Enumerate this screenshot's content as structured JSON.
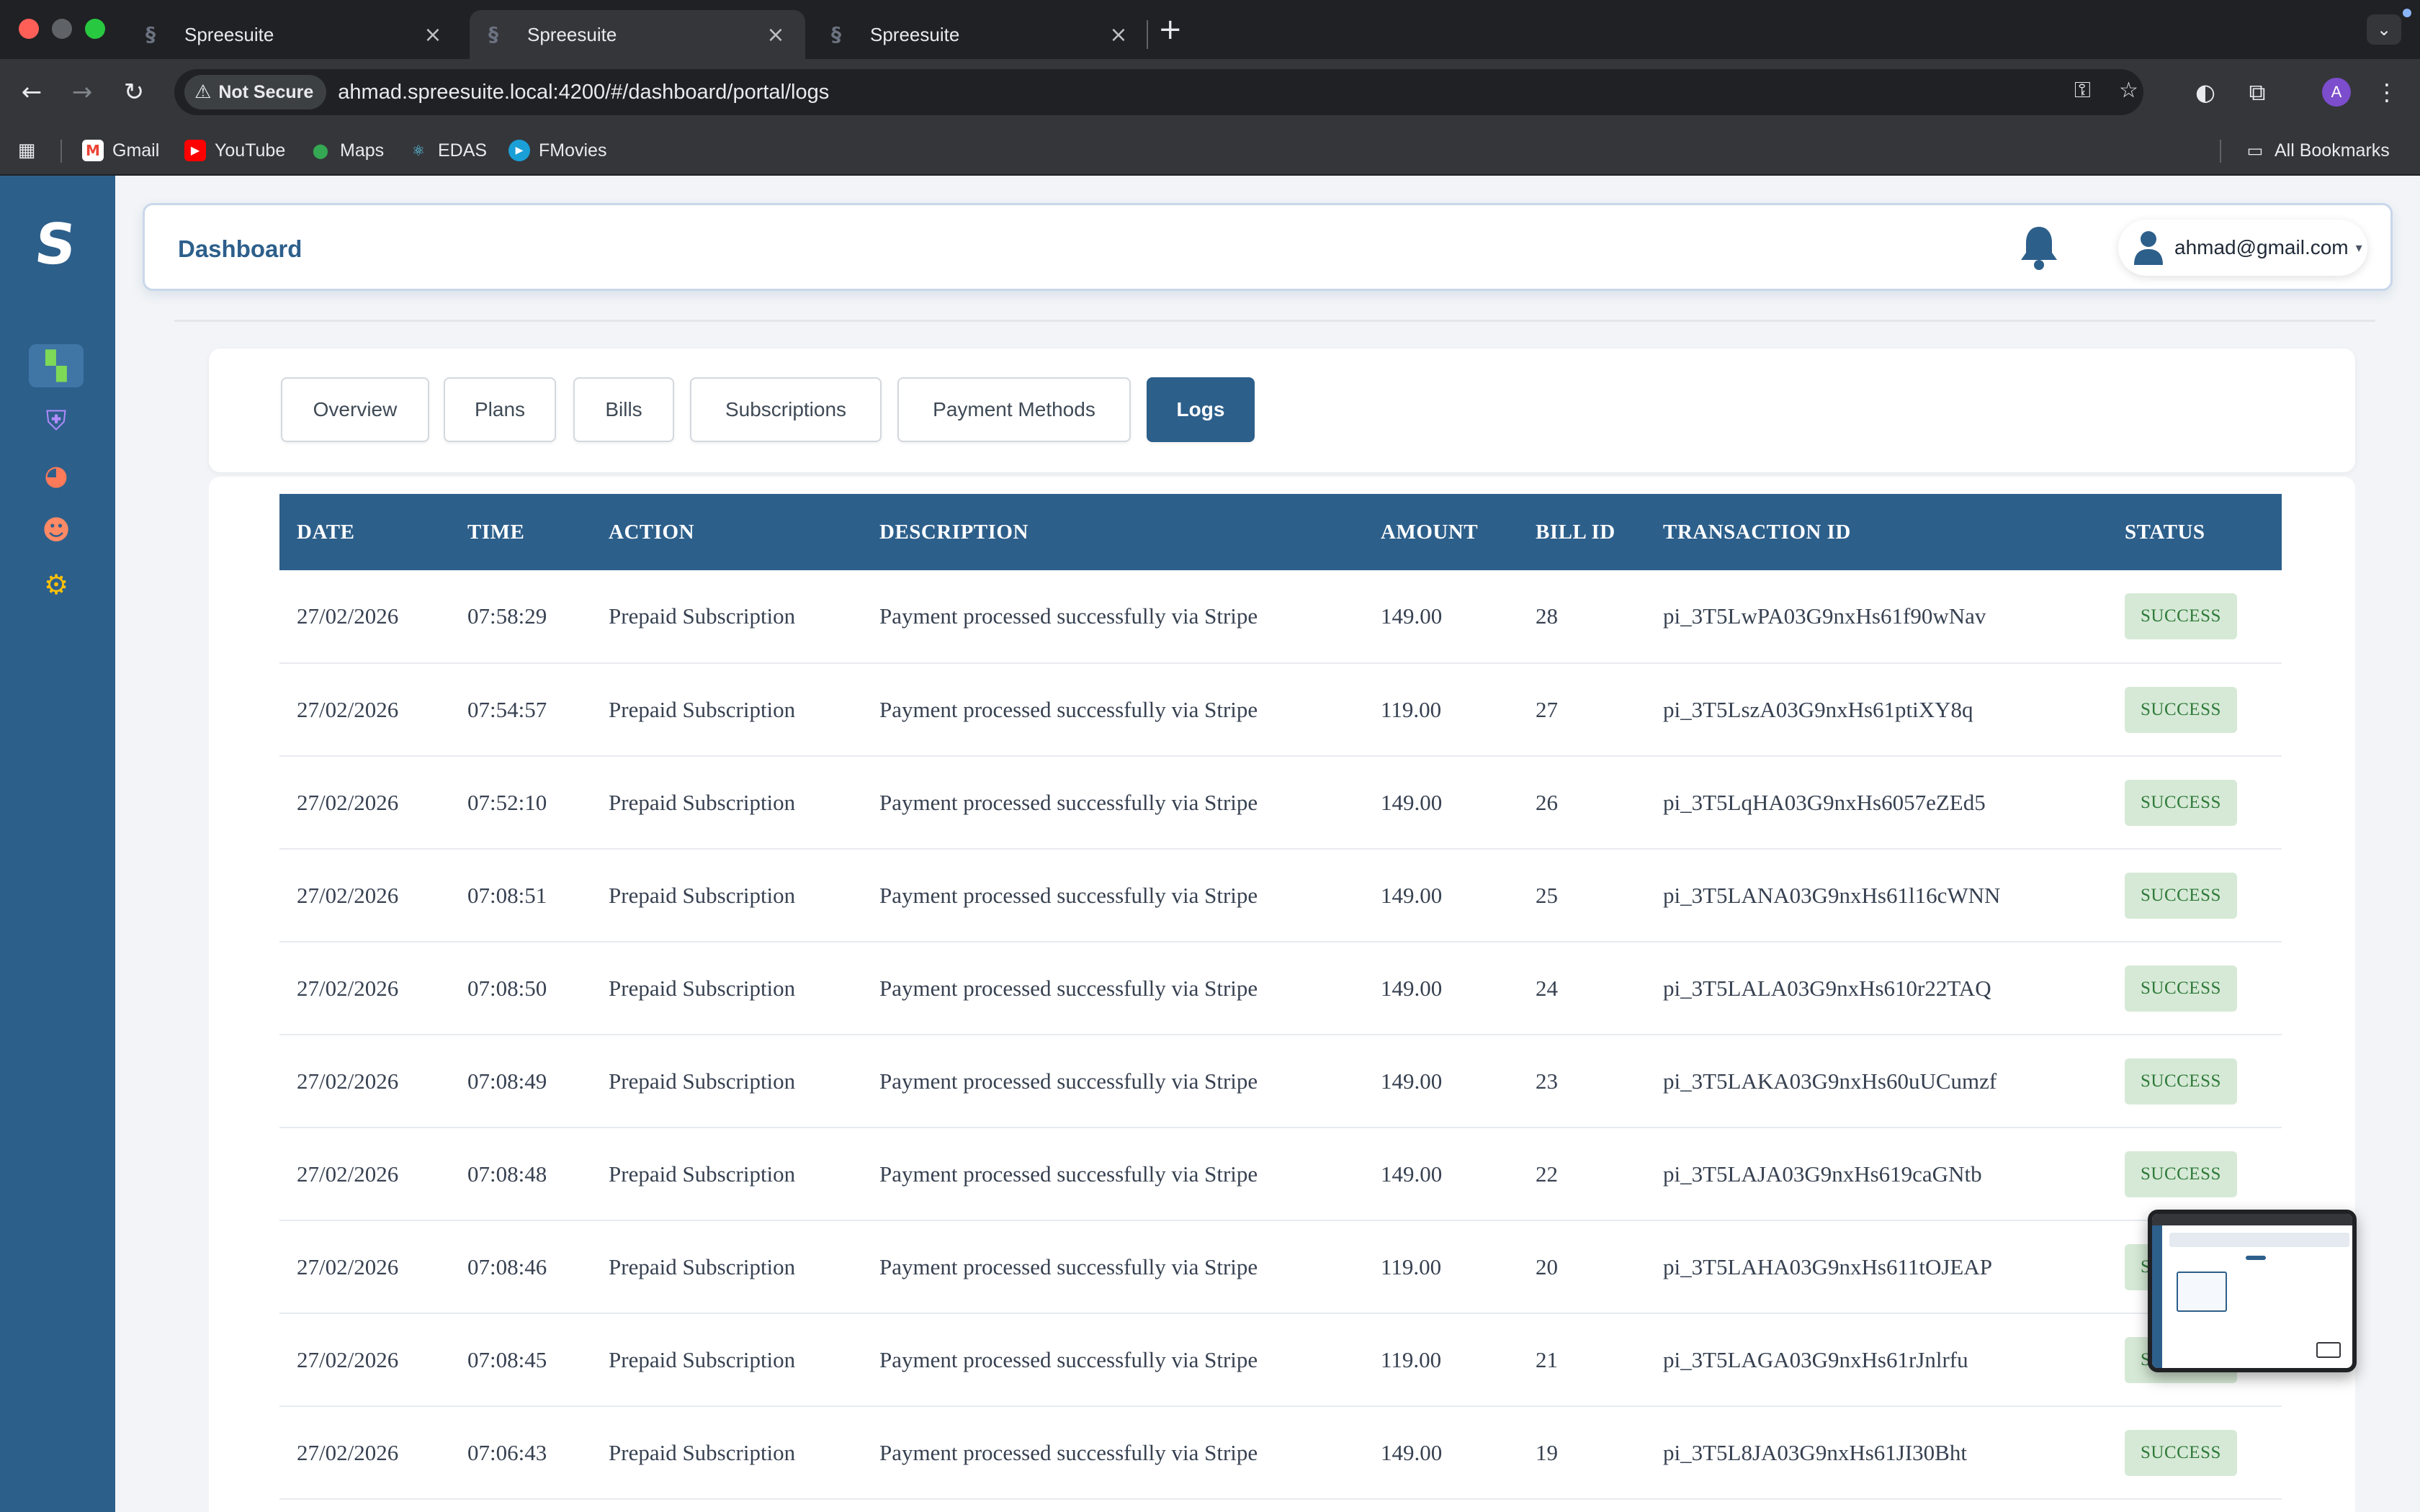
{
  "browser": {
    "tabs": [
      {
        "title": "Spreesuite",
        "active": false
      },
      {
        "title": "Spreesuite",
        "active": true
      },
      {
        "title": "Spreesuite",
        "active": false
      }
    ],
    "security_label": "Not Secure",
    "url": "ahmad.spreesuite.local:4200/#/dashboard/portal/logs",
    "profile_initial": "A",
    "bookmarks": [
      {
        "label": "Gmail",
        "icon": "gmail-icon"
      },
      {
        "label": "YouTube",
        "icon": "youtube-icon"
      },
      {
        "label": "Maps",
        "icon": "maps-icon"
      },
      {
        "label": "EDAS",
        "icon": "edas-icon"
      },
      {
        "label": "FMovies",
        "icon": "fmovies-icon"
      }
    ],
    "all_bookmarks_label": "All Bookmarks"
  },
  "colors": {
    "brand": "#2d5f8b",
    "success_bg": "#d6e9d6",
    "success_text": "#2f7a3a"
  },
  "header": {
    "title": "Dashboard",
    "user_email": "ahmad@gmail.com"
  },
  "tabs": [
    {
      "label": "Overview",
      "active": false
    },
    {
      "label": "Plans",
      "active": false
    },
    {
      "label": "Bills",
      "active": false
    },
    {
      "label": "Subscriptions",
      "active": false
    },
    {
      "label": "Payment Methods",
      "active": false
    },
    {
      "label": "Logs",
      "active": true
    }
  ],
  "table": {
    "columns": [
      "DATE",
      "TIME",
      "ACTION",
      "DESCRIPTION",
      "AMOUNT",
      "BILL ID",
      "TRANSACTION ID",
      "STATUS"
    ],
    "rows": [
      {
        "date": "27/02/2026",
        "time": "07:58:29",
        "action": "Prepaid Subscription",
        "description": "Payment processed successfully via Stripe",
        "amount": "149.00",
        "bill_id": "28",
        "transaction_id": "pi_3T5LwPA03G9nxHs61f90wNav",
        "status": "SUCCESS"
      },
      {
        "date": "27/02/2026",
        "time": "07:54:57",
        "action": "Prepaid Subscription",
        "description": "Payment processed successfully via Stripe",
        "amount": "119.00",
        "bill_id": "27",
        "transaction_id": "pi_3T5LszA03G9nxHs61ptiXY8q",
        "status": "SUCCESS"
      },
      {
        "date": "27/02/2026",
        "time": "07:52:10",
        "action": "Prepaid Subscription",
        "description": "Payment processed successfully via Stripe",
        "amount": "149.00",
        "bill_id": "26",
        "transaction_id": "pi_3T5LqHA03G9nxHs6057eZEd5",
        "status": "SUCCESS"
      },
      {
        "date": "27/02/2026",
        "time": "07:08:51",
        "action": "Prepaid Subscription",
        "description": "Payment processed successfully via Stripe",
        "amount": "149.00",
        "bill_id": "25",
        "transaction_id": "pi_3T5LANA03G9nxHs61l16cWNN",
        "status": "SUCCESS"
      },
      {
        "date": "27/02/2026",
        "time": "07:08:50",
        "action": "Prepaid Subscription",
        "description": "Payment processed successfully via Stripe",
        "amount": "149.00",
        "bill_id": "24",
        "transaction_id": "pi_3T5LALA03G9nxHs610r22TAQ",
        "status": "SUCCESS"
      },
      {
        "date": "27/02/2026",
        "time": "07:08:49",
        "action": "Prepaid Subscription",
        "description": "Payment processed successfully via Stripe",
        "amount": "149.00",
        "bill_id": "23",
        "transaction_id": "pi_3T5LAKA03G9nxHs60uUCumzf",
        "status": "SUCCESS"
      },
      {
        "date": "27/02/2026",
        "time": "07:08:48",
        "action": "Prepaid Subscription",
        "description": "Payment processed successfully via Stripe",
        "amount": "149.00",
        "bill_id": "22",
        "transaction_id": "pi_3T5LAJA03G9nxHs619caGNtb",
        "status": "SUCCESS"
      },
      {
        "date": "27/02/2026",
        "time": "07:08:46",
        "action": "Prepaid Subscription",
        "description": "Payment processed successfully via Stripe",
        "amount": "119.00",
        "bill_id": "20",
        "transaction_id": "pi_3T5LAHA03G9nxHs611tOJEAP",
        "status": "SUCCESS"
      },
      {
        "date": "27/02/2026",
        "time": "07:08:45",
        "action": "Prepaid Subscription",
        "description": "Payment processed successfully via Stripe",
        "amount": "119.00",
        "bill_id": "21",
        "transaction_id": "pi_3T5LAGA03G9nxHs61rJnlrfu",
        "status": "SUCCESS"
      },
      {
        "date": "27/02/2026",
        "time": "07:06:43",
        "action": "Prepaid Subscription",
        "description": "Payment processed successfully via Stripe",
        "amount": "149.00",
        "bill_id": "19",
        "transaction_id": "pi_3T5L8JA03G9nxHs61JI30Bht",
        "status": "SUCCESS"
      }
    ]
  }
}
